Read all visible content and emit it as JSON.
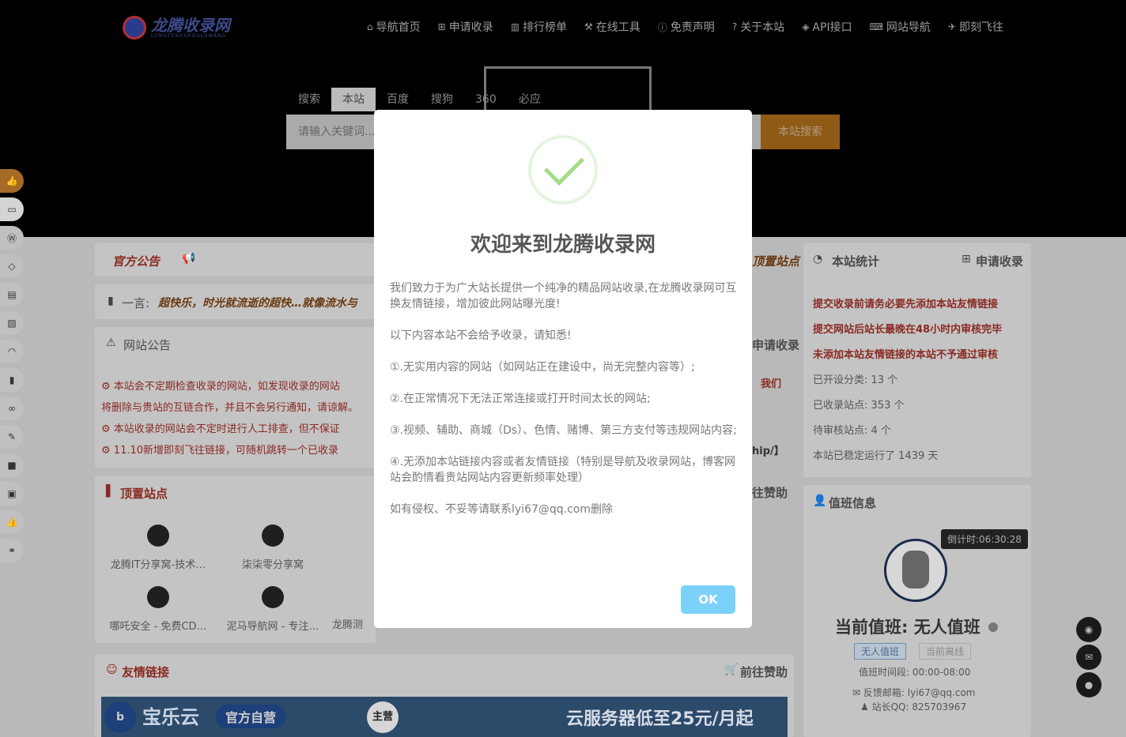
{
  "site": {
    "logo_name": "龙腾收录网",
    "logo_sub": "LONGTENGSHOULUWANG"
  },
  "nav": [
    {
      "icon": "home-icon",
      "glyph": "⌂",
      "label": "导航首页"
    },
    {
      "icon": "plus-square-icon",
      "glyph": "⊞",
      "label": "申请收录"
    },
    {
      "icon": "bar-chart-icon",
      "glyph": "▥",
      "label": "排行榜单"
    },
    {
      "icon": "wrench-icon",
      "glyph": "⚒",
      "label": "在线工具"
    },
    {
      "icon": "info-circle-icon",
      "glyph": "ⓘ",
      "label": "免责声明"
    },
    {
      "icon": "question-circle-icon",
      "glyph": "?",
      "label": "关于本站"
    },
    {
      "icon": "html5-icon",
      "glyph": "◈",
      "label": "API接口"
    },
    {
      "icon": "keyboard-icon",
      "glyph": "⌨",
      "label": "网站导航"
    },
    {
      "icon": "plane-icon",
      "glyph": "✈",
      "label": "即刻飞往"
    }
  ],
  "search": {
    "tabs": [
      "搜索",
      "本站",
      "百度",
      "搜狗",
      "360",
      "必应"
    ],
    "active_tab": "本站",
    "placeholder": "请输入关键词...",
    "button": "本站搜索"
  },
  "left": {
    "official_notice": "官方公告",
    "yiyan_label": "一言:",
    "yiyan": "超快乐，时光就流逝的超快…就像流水与",
    "notice_title": "网站公告",
    "notices": [
      "本站会不定期检查收录的网站，如发现收录的网站",
      "将删除与贵站的互链合作，并且不会另行通知，请谅解。",
      "本站收录的网站会不定时进行人工排查，但不保证",
      "11.10新增即刻飞往链接，可随机跳转一个已收录"
    ],
    "top_sites_title": "顶置站点",
    "sites": [
      "龙腾IT分享窝-技术…",
      "柒柒零分享窝",
      "哪吒安全 - 免费CD…",
      "泥马导航网 - 专注…",
      "龙腾测"
    ],
    "friends_title": "友情链接",
    "friends_right": "前往赞助",
    "banner": {
      "brand": "宝乐云",
      "tag": "官方自营",
      "badge": "主营",
      "slogan": "云服务器低至25元/月起"
    }
  },
  "mid_partial": [
    "顶置站点",
    "申请收录",
    "我们",
    "hip/】",
    "往赞助"
  ],
  "stats": {
    "title": "本站统计",
    "apply": "申请收录",
    "notes": [
      "提交收录前请务必要先添加本站友情链接",
      "提交网站后站长最晚在48小时内审核完毕",
      "未添加本站友情链接的本站不予通过审核"
    ],
    "lines": [
      {
        "label": "已开设分类:",
        "value": "13 个"
      },
      {
        "label": "已收录站点:",
        "value": "353 个"
      },
      {
        "label": "待审核站点:",
        "value": "4 个"
      },
      {
        "label": "本站已稳定运行了",
        "value": "1439 天"
      }
    ]
  },
  "duty": {
    "title": "值班信息",
    "countdown": "倒计时:06:30:28",
    "current": "当前值班: 无人值班",
    "badge1": "无人值班",
    "badge2": "当前离线",
    "period": "值班时间段: 00:00-08:00",
    "email_label": "反馈邮箱:",
    "email": "lyi67@qq.com",
    "qq_label": "站长QQ:",
    "qq": "825703967"
  },
  "modal": {
    "title": "欢迎来到龙腾收录网",
    "p1": "我们致力于为广大站长提供一个纯净的精品网站收录,在龙腾收录网可互换友情链接，增加彼此网站曝光度!",
    "p2": "以下内容本站不会给予收录，请知悉!",
    "p3": "①.无实用内容的网站（如网站正在建设中，尚无完整内容等）;",
    "p4": "②.在正常情况下无法正常连接或打开时间太长的网站;",
    "p5": "③.视频、辅助、商城（Ds）、色情、赌博、第三方支付等违规网站内容;",
    "p6": "④.无添加本站链接内容或者友情链接（特别是导航及收录网站，博客网站会酌情看贵站网站内容更新频率处理）",
    "p7": "如有侵权、不妥等请联系lyi67@qq.com删除",
    "ok": "OK"
  }
}
